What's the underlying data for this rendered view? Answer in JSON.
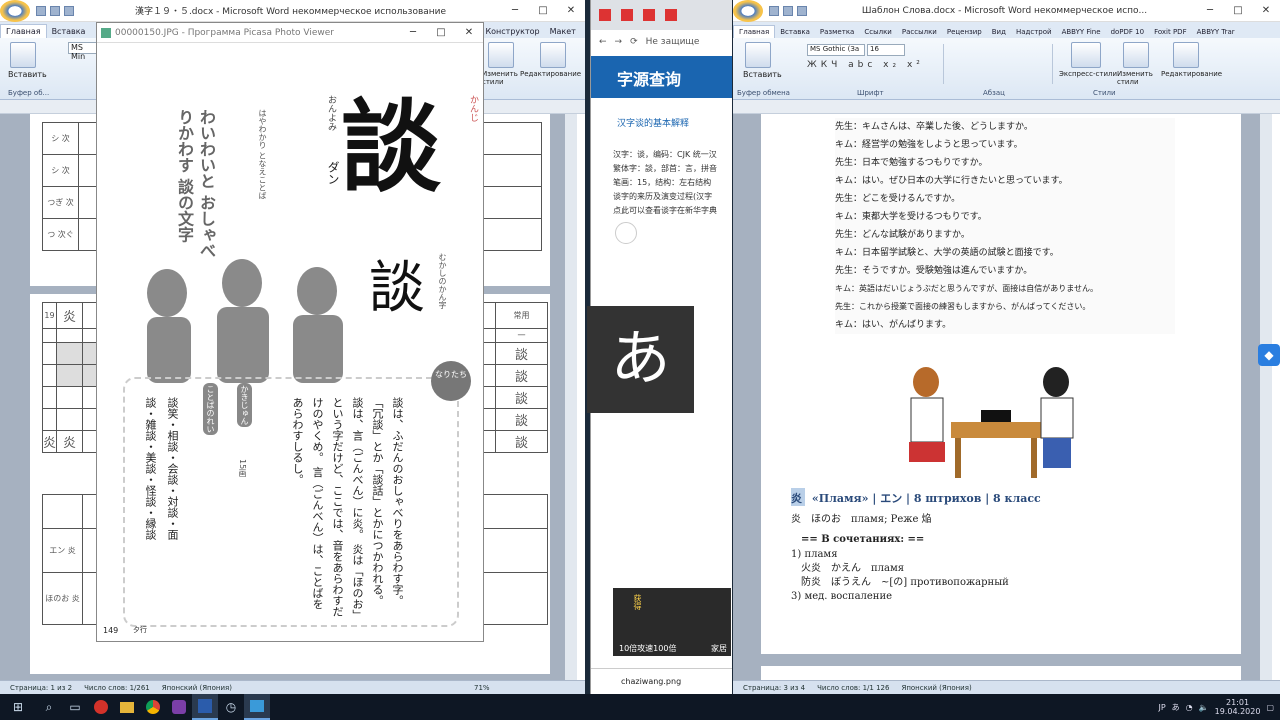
{
  "left_word": {
    "title": "漢字１９・５.docx - Microsoft Word некоммерческое использование",
    "tabs": [
      "Главная",
      "Вставка",
      "Конструктор",
      "Макет"
    ],
    "groups": {
      "clipboard": "Буфер об...",
      "paste": "Вставить",
      "styles_btn": "Изменить стили",
      "edit": "Редактирование",
      "font_name": "MS Min"
    },
    "grid": {
      "rows1": [
        "シ 次",
        "シ 次",
        "つぎ 次",
        "つ 次ぐ"
      ],
      "row19": [
        "19",
        "炎"
      ],
      "hdr": [
        "N",
        "常用",
        "3年",
        "8級",
        "一"
      ],
      "kanji_cells": [
        "談",
        "談",
        "談",
        "談",
        "談",
        "談",
        "談",
        "談"
      ],
      "bottom": [
        "炎",
        "炎"
      ],
      "bottom_r": [
        "談",
        "談",
        "談"
      ],
      "rows3": [
        "エン 炎",
        "ほのお 炎"
      ]
    },
    "status": {
      "page": "Страница: 1 из 2",
      "words": "Число слов: 1/261",
      "lang": "Японский (Япония)",
      "zoom": "71%"
    }
  },
  "picasa": {
    "title": "00000150.JPG - Программа Picasa Photo Viewer",
    "big_kanji": "談",
    "reading_on": "ダン",
    "kun_label": "おんよみ",
    "kanji_label": "かんじ",
    "vertical1": "はやわかり となえことば",
    "vertical2": "わいわいと おしゃべりかわす 談の文字",
    "seal_kanji": "談",
    "old_label": "むかしのかん字",
    "origin_label": "なりたち",
    "explanation": "談は、ふだんのおしゃべりをあらわす字。「冗談」とか「談話」とかにつかわれる。 談は、言（ごんべん）に炎。 炎は「ほのお」という字だけど、ここでは、音をあらわすだけのやくめ。 言（ごんべん）は、ことばをあらわすしるし。",
    "stroke_label": "かきじゅん",
    "stroke_count": "15画",
    "example_label": "ことばのれい",
    "examples": "談笑・相談・会談・対談・面談・雑談・美談・怪談・縁談",
    "page_no": "149",
    "footer": "夕行"
  },
  "browser": {
    "url": "Не защище",
    "site": "字源查询",
    "link": "汉字谈的基本解释",
    "lines": [
      "汉字：谈，编码：CJK 统一汉",
      "繁体字：談，部首：言，拼音",
      "笔画：15，结构：左右结构",
      "谈字的来历及演变过程(汉字",
      "点此可以查看谈字在新华字典"
    ],
    "ad_lines": [
      "获得",
      "前二",
      "技能"
    ],
    "ad_text": "10倍攻速100倍",
    "ad_side": "家居",
    "file": "chaziwang.png"
  },
  "ime": {
    "char": "あ"
  },
  "right_word": {
    "title": "Шаблон Слова.docx - Microsoft Word некоммерческое испо...",
    "tabs": [
      "Главная",
      "Вставка",
      "Разметка",
      "Ссылки",
      "Рассылки",
      "Рецензир",
      "Вид",
      "Надстрой",
      "ABBYY Fine",
      "doPDF 10",
      "Foxit PDF",
      "ABBYY Trar",
      "ABBYY Trar"
    ],
    "font_name": "MS Gothic (За",
    "font_size": "16",
    "groups": {
      "clipboard": "Буфер обмена",
      "font": "Шрифт",
      "para": "Абзац",
      "styles": "Стили",
      "paste": "Вставить",
      "express": "Экспресс-стили",
      "change": "Изменить стили",
      "edit": "Редактирование"
    },
    "dialogue": [
      "先生：キムさんは、卒業した後、どうしますか。",
      "キム：経営学の勉強をしようと思っています。",
      "先生：日本で勉強するつもりですか。",
      "キム：はい。ぜひ日本の大学に行きたいと思っています。",
      "先生：どこを受けるんですか。",
      "キム：東都大学を受けるつもりです。",
      "先生：どんな試験がありますか。",
      "キム：日本留学試験と、大学の英語の試験と面接です。",
      "先生：そうですか。受験勉強は進んでいますか。",
      "キム：英語はだいじょうぶだと思うんですが、面接は自信がありません。",
      "先生：これから授業で面接の練習もしますから、がんばってください。",
      "キム：はい、がんばります。"
    ],
    "entry_kanji": "炎",
    "entry_head": "«Пламя» | エン | 8 штрихов | 8 класс",
    "entry_line2": "炎　ほのお　пламя; Реже 焔",
    "combo_head": "== В сочетаниях: ==",
    "combo1": "1) пламя",
    "combo2": "火炎　かえん　пламя",
    "combo3": "防炎　ぼうえん　~[の] противопожарный",
    "combo4": "3) мед. воспаление",
    "status": {
      "page": "Страница: 3 из 4",
      "words": "Число слов: 1/1 126",
      "lang": "Японский (Япония)"
    }
  },
  "taskbar": {
    "lang": "JP",
    "time": "21:01",
    "date": "19.04.2020"
  }
}
